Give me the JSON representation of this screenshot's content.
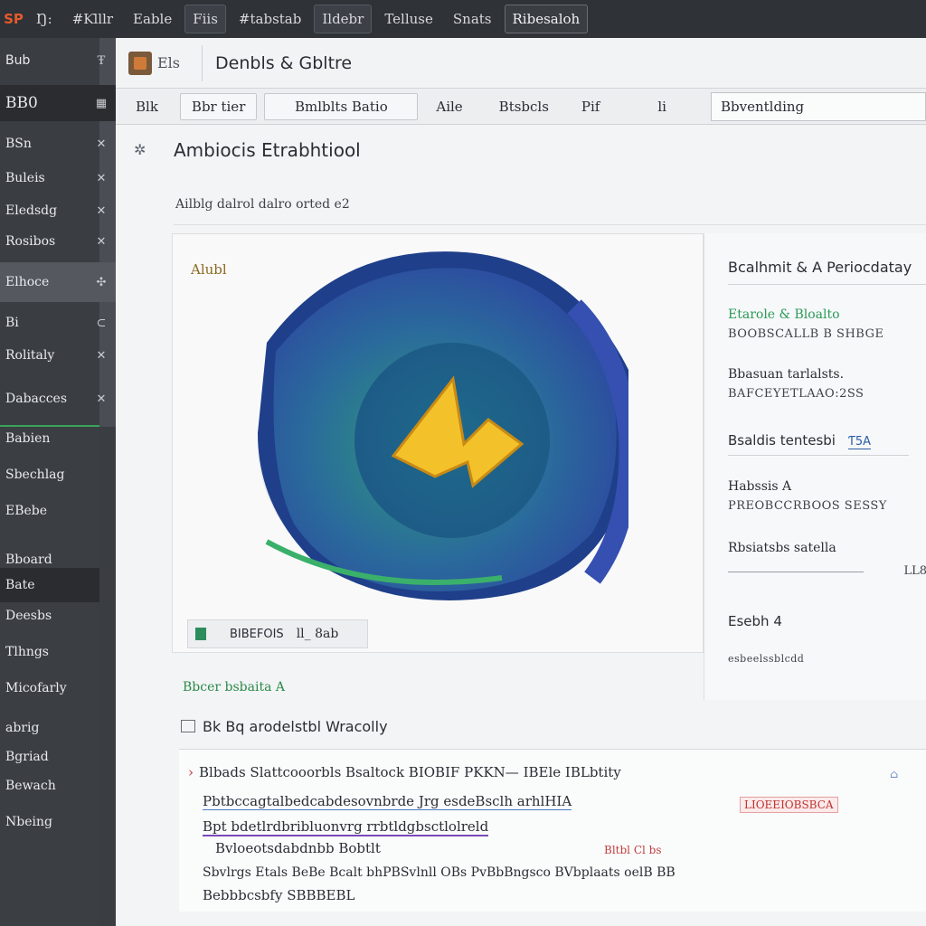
{
  "topbar": {
    "logo": "SP",
    "items": [
      "Ŋ:",
      "#Ƙlllr",
      "Eable",
      "Fiis",
      "#tabstab",
      "Ildebr",
      "Telluse",
      "Snats",
      "Ribesaloh"
    ]
  },
  "sidebar": {
    "top_label": "Bub",
    "top_icon": "Ŧ",
    "items": [
      {
        "label": "BB0",
        "icon": "▦"
      },
      {
        "label": "BSn",
        "icon": "✕"
      },
      {
        "label": "Buleis",
        "icon": "✕"
      },
      {
        "label": "Eledsdg",
        "icon": "✕"
      },
      {
        "label": "Rosibos",
        "icon": "✕"
      },
      {
        "label": "Elhoce",
        "icon": "✣"
      },
      {
        "label": "Bi",
        "icon": "⊂"
      },
      {
        "label": "Rolitaly",
        "icon": "✕"
      },
      {
        "label": "Dabacces",
        "icon": "✕"
      }
    ],
    "lower_items": [
      "Babien",
      "Sbechlag",
      "EBebe",
      "Bboard",
      "Bate",
      "Deesbs",
      "Tlhngs",
      "Micofarly",
      "abrig",
      "Bgriad",
      "Bewach",
      "Nbeing"
    ]
  },
  "header": {
    "sub": "Els",
    "title": "Denbls & Gbltre"
  },
  "tabs": {
    "items": [
      "Blk",
      "Bbr tier",
      "Bmlblts Batio",
      "Aile",
      "Btsbcls",
      "Pif",
      "li"
    ],
    "search_value": "Bbventlding"
  },
  "main": {
    "page_title": "Ambiocis Etrabhtiool",
    "subtitle": "Ailblg dalrol dalro orted e2",
    "card": {
      "label": "Alubl",
      "footer_label": "BIBEFOIS",
      "footer_value": "ll_ 8ab"
    },
    "props": {
      "heading": "Bcalhmit & A Periocdatay",
      "rows": [
        {
          "key": "Etarole & Bloalto",
          "value": "BOOBSCALLB B SHBGE",
          "green": true
        },
        {
          "key": "Bbasuan tarlalsts.",
          "value": "BAFCEYETLAAO:2SS"
        },
        {
          "key": "Bsaldis tentesbi",
          "value": "",
          "badge": "Ƭ5A"
        },
        {
          "key": "Habssis A",
          "value": "PREOBCCRBOOS SESSY"
        },
        {
          "key": "Rbsiatsbs satella",
          "value": "",
          "badge2": "LL8"
        },
        {
          "key": "Esebh 4",
          "value": "esbeelssblcdd"
        }
      ]
    },
    "activity": {
      "link": "Bbcer bsbaita A",
      "heading": "Bk Bq arodelstbl Wracolly",
      "lines": [
        "Blbads Slattcooorbls Bsaltock BIOBIF PKKN— IBEle IBLbtity",
        "Pbtbccagtalbedcabdesovnbrde Jrg esdeBsclh arhlHIA",
        "Bpt bdetlrdbribluonvrg rrbtldgbsctlolreld",
        "Bvloeotsdabdnbb Bobtlt",
        "Sbvlrgs Etals BeBe Bcalt bhPBSvlnll OBs PvBbBngsco BVbplaats oelB BB",
        "Bebbbcsbfy SBBBEBL"
      ],
      "tag_red": "LIOEEIOBSBCA",
      "tag_red2": "Bltbl Cl bs",
      "tag_icon": "⌂"
    }
  },
  "colors": {
    "topbar_bg": "#2f3237",
    "sidebar_bg": "#3a3d42",
    "accent_green": "#3aa35a",
    "badge_blue": "#2a5ca8",
    "alert_red": "#c03030"
  }
}
